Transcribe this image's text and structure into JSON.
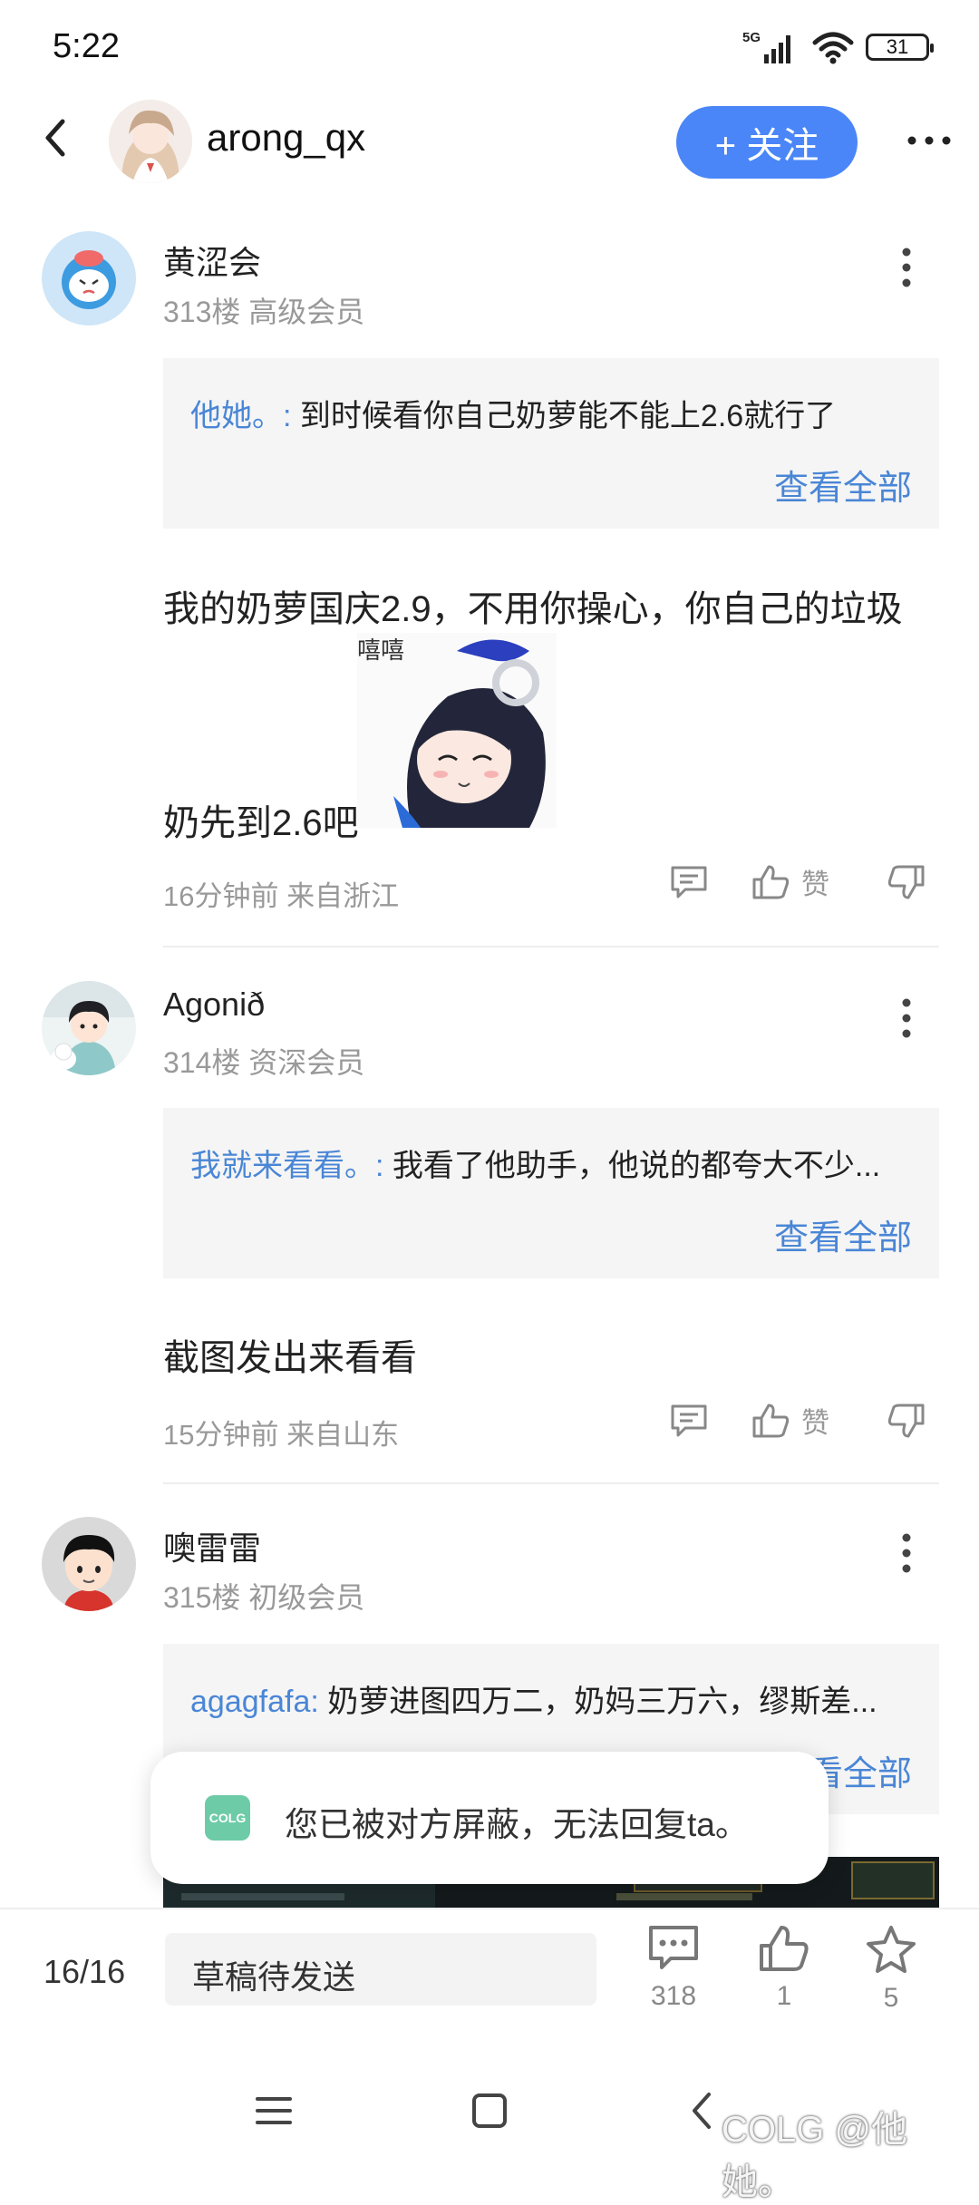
{
  "status_bar": {
    "time": "5:22",
    "network": "5G",
    "battery": "31"
  },
  "header": {
    "username": "arong_qx",
    "follow_label": "+ 关注"
  },
  "posts": [
    {
      "username": "黄涩会",
      "floor_level": "313楼 高级会员",
      "quote_user": "他她。:",
      "quote_text": "到时候看你自己奶萝能不能上2.6就行了",
      "view_all": "查看全部",
      "text_line1": "我的奶萝国庆2.9，不用你操心，你自己的垃圾",
      "sticker_caption": "嘻嘻",
      "text_line2": "奶先到2.6吧",
      "time_loc": "16分钟前 来自浙江",
      "like_label": "赞"
    },
    {
      "username": "Agonið",
      "floor_level": "314楼 资深会员",
      "quote_user": "我就来看看。:",
      "quote_text": "我看了他助手，他说的都夸大不少...",
      "view_all": "查看全部",
      "text_line1": "截图发出来看看",
      "time_loc": "15分钟前 来自山东",
      "like_label": "赞"
    },
    {
      "username": "噢雷雷",
      "floor_level": "315楼 初级会员",
      "quote_user": "agagfafa:",
      "quote_text": "奶萝进图四万二，奶妈三万六，缪斯差...",
      "view_all": "查看全部"
    }
  ],
  "toast": {
    "icon_text": "COLG",
    "message": "您已被对方屏蔽，无法回复ta。"
  },
  "bottom_bar": {
    "pager": "16/16",
    "draft_placeholder": "草稿待发送",
    "comment_count": "318",
    "like_count": "1",
    "fav_count": "5"
  },
  "watermark": "COLG @他她。",
  "colors": {
    "accent": "#4a86f7",
    "link": "#4a86d6",
    "meta": "#999999",
    "quote_bg": "#f5f5f5"
  }
}
